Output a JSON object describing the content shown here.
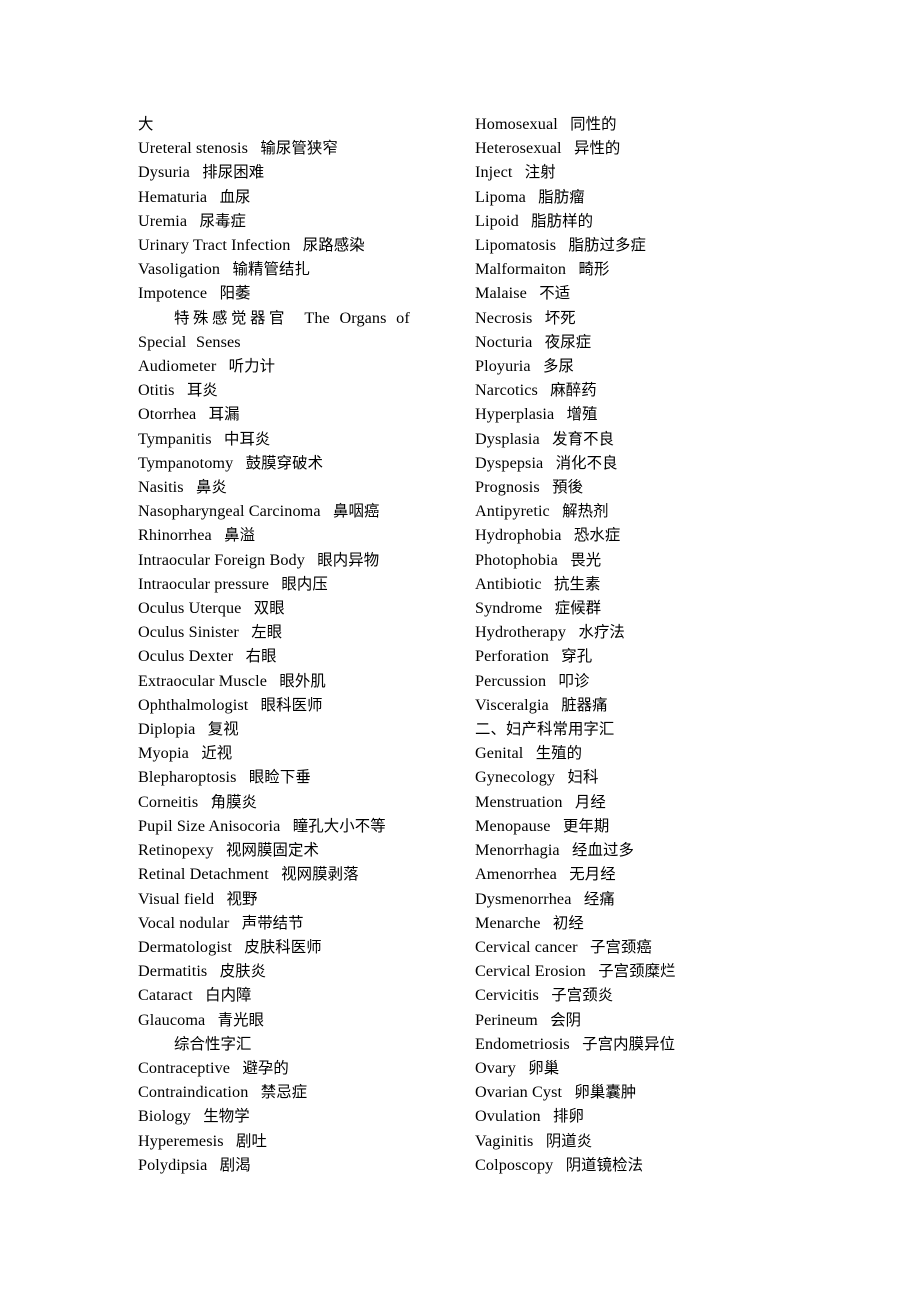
{
  "document": {
    "type": "vocabulary-list",
    "background_color": "#ffffff",
    "text_color": "#000000",
    "columns": 2
  },
  "left_column": [
    {
      "en": "",
      "cn": "大"
    },
    {
      "en": "Ureteral stenosis",
      "cn": "输尿管狭窄"
    },
    {
      "en": "Dysuria",
      "cn": "排尿困难"
    },
    {
      "en": "Hematuria",
      "cn": "血尿"
    },
    {
      "en": "Uremia",
      "cn": "尿毒症"
    },
    {
      "en": "Urinary Tract Infection",
      "cn": "尿路感染"
    },
    {
      "en": "Vasoligation",
      "cn": "输精管结扎"
    },
    {
      "en": "Impotence",
      "cn": "阳萎"
    },
    {
      "en": "The Organs of Special Senses",
      "cn": "特殊感觉器官",
      "style": "section-wrap"
    },
    {
      "en": "Audiometer",
      "cn": "听力计"
    },
    {
      "en": "Otitis",
      "cn": "耳炎"
    },
    {
      "en": "Otorrhea",
      "cn": "耳漏"
    },
    {
      "en": "Tympanitis",
      "cn": "中耳炎"
    },
    {
      "en": "Tympanotomy",
      "cn": "鼓膜穿破术"
    },
    {
      "en": "Nasitis",
      "cn": "鼻炎"
    },
    {
      "en": "Nasopharyngeal Carcinoma",
      "cn": "鼻咽癌"
    },
    {
      "en": "Rhinorrhea",
      "cn": "鼻溢"
    },
    {
      "en": "Intraocular Foreign Body",
      "cn": "眼内异物"
    },
    {
      "en": "Intraocular pressure",
      "cn": "眼内压"
    },
    {
      "en": "Oculus Uterque",
      "cn": "双眼"
    },
    {
      "en": "Oculus Sinister",
      "cn": "左眼"
    },
    {
      "en": "Oculus Dexter",
      "cn": "右眼"
    },
    {
      "en": "Extraocular Muscle",
      "cn": "眼外肌"
    },
    {
      "en": "Ophthalmologist",
      "cn": "眼科医师"
    },
    {
      "en": "Diplopia",
      "cn": "复视"
    },
    {
      "en": "Myopia",
      "cn": "近视"
    },
    {
      "en": "Blepharoptosis",
      "cn": "眼睑下垂"
    },
    {
      "en": "Corneitis",
      "cn": "角膜炎"
    },
    {
      "en": "Pupil Size Anisocoria",
      "cn": "瞳孔大小不等"
    },
    {
      "en": "Retinopexy",
      "cn": "视网膜固定术"
    },
    {
      "en": "Retinal Detachment",
      "cn": "视网膜剥落"
    },
    {
      "en": "Visual field",
      "cn": "视野"
    },
    {
      "en": "Vocal nodular",
      "cn": "声带结节"
    },
    {
      "en": "Dermatologist",
      "cn": "皮肤科医师"
    },
    {
      "en": "Dermatitis",
      "cn": "皮肤炎"
    },
    {
      "en": "Cataract",
      "cn": "白内障"
    },
    {
      "en": "Glaucoma",
      "cn": "青光眼"
    },
    {
      "en": "",
      "cn": "综合性字汇",
      "style": "indent"
    },
    {
      "en": "Contraceptive",
      "cn": "避孕的"
    },
    {
      "en": "Contraindication",
      "cn": "禁忌症"
    },
    {
      "en": "Biology",
      "cn": "生物学"
    },
    {
      "en": "Hyperemesis",
      "cn": "剧吐"
    },
    {
      "en": "Polydipsia",
      "cn": "剧渴"
    }
  ],
  "right_column": [
    {
      "en": "Homosexual",
      "cn": "同性的"
    },
    {
      "en": "Heterosexual",
      "cn": "异性的"
    },
    {
      "en": "Inject",
      "cn": "注射"
    },
    {
      "en": "Lipoma",
      "cn": "脂肪瘤"
    },
    {
      "en": "Lipoid",
      "cn": "脂肪样的"
    },
    {
      "en": "Lipomatosis",
      "cn": "脂肪过多症"
    },
    {
      "en": "Malformaiton",
      "cn": "畸形"
    },
    {
      "en": "Malaise",
      "cn": "不适"
    },
    {
      "en": "Necrosis",
      "cn": "坏死"
    },
    {
      "en": "Nocturia",
      "cn": "夜尿症"
    },
    {
      "en": "Ployuria",
      "cn": "多尿"
    },
    {
      "en": "Narcotics",
      "cn": "麻醉药"
    },
    {
      "en": "Hyperplasia",
      "cn": "增殖"
    },
    {
      "en": "Dysplasia",
      "cn": "发育不良"
    },
    {
      "en": "Dyspepsia",
      "cn": "消化不良"
    },
    {
      "en": "Prognosis",
      "cn": "預後"
    },
    {
      "en": "Antipyretic",
      "cn": "解热剂"
    },
    {
      "en": "Hydrophobia",
      "cn": "恐水症"
    },
    {
      "en": "Photophobia",
      "cn": "畏光"
    },
    {
      "en": "Antibiotic",
      "cn": "抗生素"
    },
    {
      "en": "Syndrome",
      "cn": "症候群"
    },
    {
      "en": "Hydrotherapy",
      "cn": "水疗法"
    },
    {
      "en": "Perforation",
      "cn": "穿孔"
    },
    {
      "en": "Percussion",
      "cn": "叩诊"
    },
    {
      "en": "Visceralgia",
      "cn": "脏器痛"
    },
    {
      "en": "",
      "cn": "二、妇产科常用字汇"
    },
    {
      "en": "Genital",
      "cn": "生殖的"
    },
    {
      "en": "Gynecology",
      "cn": "妇科"
    },
    {
      "en": "Menstruation",
      "cn": "月经"
    },
    {
      "en": "Menopause",
      "cn": "更年期"
    },
    {
      "en": "Menorrhagia",
      "cn": "经血过多"
    },
    {
      "en": "Amenorrhea",
      "cn": "无月经"
    },
    {
      "en": "Dysmenorrhea",
      "cn": "经痛"
    },
    {
      "en": "Menarche",
      "cn": "初经"
    },
    {
      "en": "Cervical cancer",
      "cn": "子宫颈癌"
    },
    {
      "en": "Cervical Erosion",
      "cn": "子宫颈糜烂"
    },
    {
      "en": "Cervicitis",
      "cn": "子宫颈炎"
    },
    {
      "en": "Perineum",
      "cn": "会阴"
    },
    {
      "en": "Endometriosis",
      "cn": "子宫内膜异位"
    },
    {
      "en": "Ovary",
      "cn": "卵巢"
    },
    {
      "en": "Ovarian Cyst",
      "cn": "卵巢囊肿"
    },
    {
      "en": "Ovulation",
      "cn": "排卵"
    },
    {
      "en": "Vaginitis",
      "cn": "阴道炎"
    },
    {
      "en": "Colposcopy",
      "cn": "阴道镜检法"
    }
  ]
}
